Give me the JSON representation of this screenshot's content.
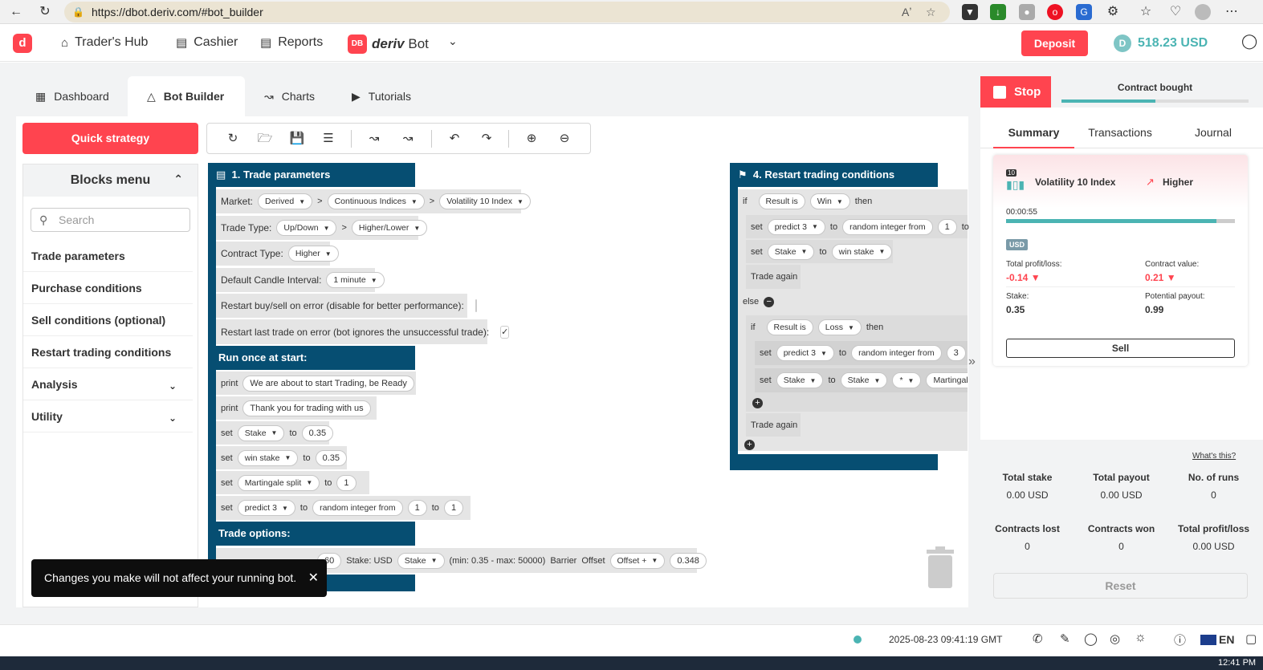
{
  "browser": {
    "url": "https://dbot.deriv.com/#bot_builder",
    "reader_label": "Aʼ"
  },
  "header": {
    "nav": [
      "Trader's Hub",
      "Cashier",
      "Reports"
    ],
    "brand_badge": "DB",
    "brand_name": "deriv",
    "brand_suffix": "Bot",
    "deposit": "Deposit",
    "balance": "518.23 USD"
  },
  "tabs": [
    "Dashboard",
    "Bot Builder",
    "Charts",
    "Tutorials"
  ],
  "quick_strategy": "Quick strategy",
  "blocks_menu": {
    "title": "Blocks menu",
    "search_placeholder": "Search",
    "items": [
      "Trade parameters",
      "Purchase conditions",
      "Sell conditions (optional)",
      "Restart trading conditions",
      "Analysis",
      "Utility"
    ]
  },
  "trade_params": {
    "title": "1. Trade parameters",
    "market_label": "Market:",
    "market": [
      "Derived",
      "Continuous Indices",
      "Volatility 10 Index"
    ],
    "trade_type_label": "Trade Type:",
    "trade_type": [
      "Up/Down",
      "Higher/Lower"
    ],
    "contract_type_label": "Contract Type:",
    "contract_type": "Higher",
    "candle_label": "Default Candle Interval:",
    "candle": "1 minute",
    "restart_buy_label": "Restart buy/sell on error (disable for better performance):",
    "restart_last_label": "Restart last trade on error (bot ignores the unsuccessful trade):",
    "restart_last_check": "✓",
    "run_once": "Run once at start:",
    "print1": "We are about to start Trading, be Ready",
    "print2": "Thank you for trading with us",
    "kw_print": "print",
    "kw_set": "set",
    "kw_to": "to",
    "sep": ">",
    "set_stake_var": "Stake",
    "set_stake_val": "0.35",
    "set_win_var": "win stake",
    "set_win_val": "0.35",
    "set_mart_var": "Martingale split",
    "set_mart_val": "1",
    "set_pred_var": "predict 3",
    "rand_label": "random integer from",
    "rand_from": "1",
    "rand_to": "1",
    "trade_options": "Trade options:",
    "opt_duration": "60",
    "opt_stake_label": "Stake:  USD",
    "opt_stake_var": "Stake",
    "opt_minmax": "(min: 0.35 - max: 50000)",
    "opt_barrier": "Barrier",
    "opt_offset_label": "Offset",
    "opt_offset": "Offset +",
    "opt_offset_val": "0.348"
  },
  "restart": {
    "title": "4. Restart trading conditions",
    "kw_if": "if",
    "kw_then": "then",
    "kw_else": "else",
    "result_is": "Result is",
    "win": "Win",
    "loss": "Loss",
    "predict": "predict 3",
    "random_from": "random integer from",
    "rnd_val_1": "1",
    "rnd_val_2": "3",
    "to_trunc": "to",
    "stake": "Stake",
    "win_stake": "win stake",
    "mult": "*",
    "mart_trunc": "Martingale s",
    "trade_again": "Trade again",
    "collapse": "»"
  },
  "run_panel": {
    "stop": "Stop",
    "contract_bought": "Contract bought",
    "contract_progress": 0.5,
    "tabs": [
      "Summary",
      "Transactions",
      "Journal"
    ],
    "badge_10": "10",
    "symbol": "Volatility 10 Index",
    "direction": "Higher",
    "timer": "00:00:55",
    "timer_progress": 0.92,
    "currency_badge": "USD",
    "total_pl_label": "Total profit/loss:",
    "total_pl": "-0.14",
    "contract_value_label": "Contract value:",
    "contract_value": "0.21",
    "stake_label": "Stake:",
    "stake": "0.35",
    "payout_label": "Potential payout:",
    "payout": "0.99",
    "sell": "Sell",
    "whats_this": "What's this?",
    "stats": [
      {
        "label": "Total stake",
        "value": "0.00 USD"
      },
      {
        "label": "Total payout",
        "value": "0.00 USD"
      },
      {
        "label": "No. of runs",
        "value": "0"
      },
      {
        "label": "Contracts lost",
        "value": "0"
      },
      {
        "label": "Contracts won",
        "value": "0"
      },
      {
        "label": "Total profit/loss",
        "value": "0.00 USD"
      }
    ],
    "reset": "Reset"
  },
  "toast": "Changes you make will not affect your running bot.",
  "footer": {
    "datetime": "2025-08-23 09:41:19 GMT",
    "lang": "EN"
  },
  "taskbar": {
    "time": "12:41 PM"
  },
  "colors": {
    "brand_red": "#ff444f",
    "block_blue": "#064e72",
    "teal": "#4bb4b3"
  }
}
